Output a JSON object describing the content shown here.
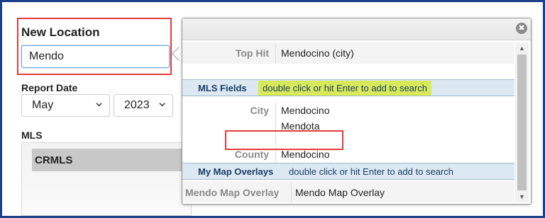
{
  "location": {
    "title": "New Location",
    "input_value": "Mendo"
  },
  "report": {
    "label": "Report Date",
    "month": "May",
    "year": "2023"
  },
  "mls": {
    "label": "MLS",
    "selected": "CRMLS"
  },
  "popup": {
    "close_symbol": "✖",
    "top_hit": {
      "key": "Top Hit",
      "value": "Mendocino  (city)"
    },
    "mls_fields": {
      "title": "MLS Fields",
      "hint": "double click or hit Enter to add to search",
      "city_key": "City",
      "city_values": [
        "Mendocino",
        "Mendota"
      ],
      "county_key": "County",
      "county_value": "Mendocino"
    },
    "map_overlays": {
      "title": "My Map Overlays",
      "hint": "double click or hit Enter to add to search",
      "key": "Mendo Map Overlay",
      "value": "Mendo Map Overlay"
    }
  },
  "colors": {
    "frame_border": "#1c3f8a",
    "highlight_red": "#e23b3b",
    "hint_yellow": "#d8ea5a",
    "section_blue": "#dce9f3"
  },
  "icons": {
    "close": "close-icon",
    "chevron": "chevron-down-icon",
    "scroll_up": "scroll-up-icon",
    "scroll_down": "scroll-down-icon"
  }
}
